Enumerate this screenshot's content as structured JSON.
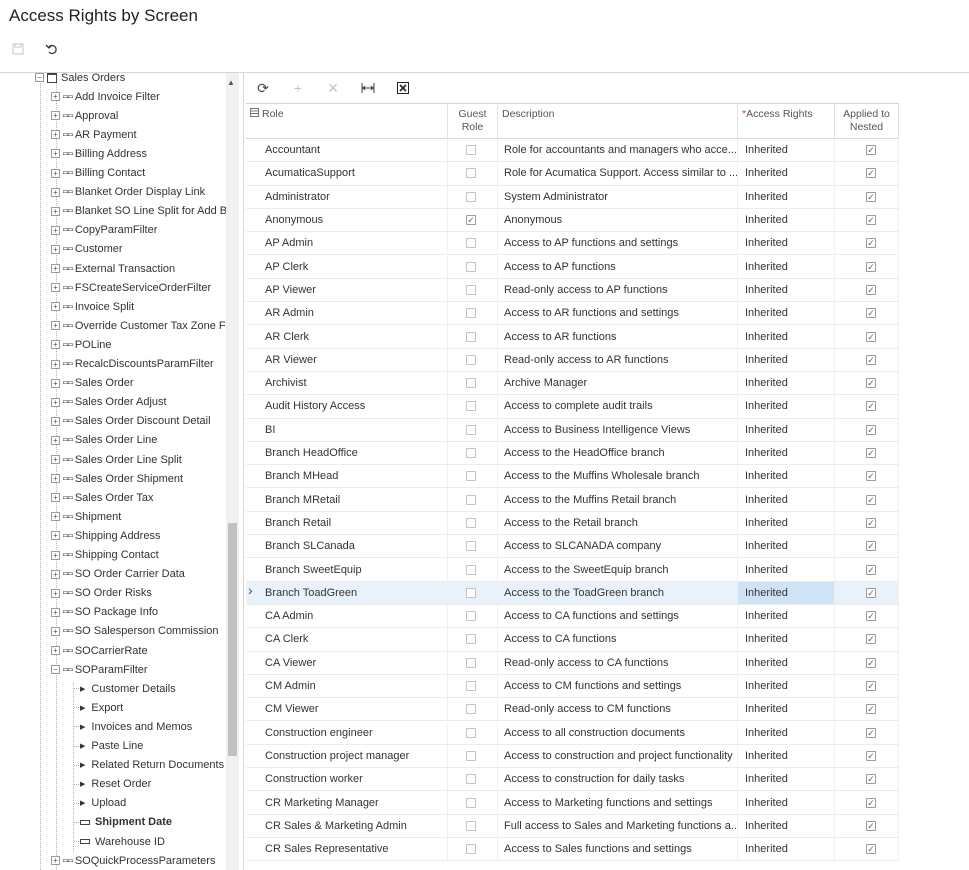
{
  "page": {
    "title": "Access Rights by Screen"
  },
  "toolbar": {
    "save_icon": "save-icon",
    "undo_icon": "undo-icon"
  },
  "tree": {
    "parent": "Sales Orders",
    "items": [
      "Add Invoice Filter",
      "Approval",
      "AR Payment",
      "Billing Address",
      "Billing Contact",
      "Blanket Order Display Link",
      "Blanket SO Line Split for Add B",
      "CopyParamFilter",
      "Customer",
      "External Transaction",
      "FSCreateServiceOrderFilter",
      "Invoice Split",
      "Override Customer Tax Zone Fi",
      "POLine",
      "RecalcDiscountsParamFilter",
      "Sales Order",
      "Sales Order Adjust",
      "Sales Order Discount Detail",
      "Sales Order Line",
      "Sales Order Line Split",
      "Sales Order Shipment",
      "Sales Order Tax",
      "Shipment",
      "Shipping Address",
      "Shipping Contact",
      "SO Order Carrier Data",
      "SO Order Risks",
      "SO Package Info",
      "SO Salesperson Commission",
      "SOCarrierRate",
      "SOParamFilter"
    ],
    "children": [
      "Customer Details",
      "Export",
      "Invoices and Memos",
      "Paste Line",
      "Related Return Documents",
      "Reset Order",
      "Upload"
    ],
    "fields": [
      "Shipment Date",
      "Warehouse ID"
    ],
    "last": "SOQuickProcessParameters"
  },
  "grid": {
    "columns": {
      "role": "Role",
      "guest_role": "Guest Role",
      "description": "Description",
      "access_rights_req": "*",
      "access_rights": "Access Rights",
      "applied_to_nested": "Applied to Nested"
    },
    "rows": [
      {
        "role": "Accountant",
        "guest": false,
        "desc": "Role for accountants and managers who acce...",
        "rights": "Inherited",
        "nested": true
      },
      {
        "role": "AcumaticaSupport",
        "guest": false,
        "desc": "Role for Acumatica Support. Access similar to ...",
        "rights": "Inherited",
        "nested": true
      },
      {
        "role": "Administrator",
        "guest": false,
        "desc": "System Administrator",
        "rights": "Inherited",
        "nested": true
      },
      {
        "role": "Anonymous",
        "guest": true,
        "desc": "Anonymous",
        "rights": "Inherited",
        "nested": true
      },
      {
        "role": "AP Admin",
        "guest": false,
        "desc": "Access to AP functions and settings",
        "rights": "Inherited",
        "nested": true
      },
      {
        "role": "AP Clerk",
        "guest": false,
        "desc": "Access to AP functions",
        "rights": "Inherited",
        "nested": true
      },
      {
        "role": "AP Viewer",
        "guest": false,
        "desc": "Read-only access to AP functions",
        "rights": "Inherited",
        "nested": true
      },
      {
        "role": "AR Admin",
        "guest": false,
        "desc": "Access to AR functions and settings",
        "rights": "Inherited",
        "nested": true
      },
      {
        "role": "AR Clerk",
        "guest": false,
        "desc": "Access to AR functions",
        "rights": "Inherited",
        "nested": true
      },
      {
        "role": "AR Viewer",
        "guest": false,
        "desc": "Read-only access to AR functions",
        "rights": "Inherited",
        "nested": true
      },
      {
        "role": "Archivist",
        "guest": false,
        "desc": "Archive Manager",
        "rights": "Inherited",
        "nested": true
      },
      {
        "role": "Audit History Access",
        "guest": false,
        "desc": "Access to complete audit trails",
        "rights": "Inherited",
        "nested": true
      },
      {
        "role": "BI",
        "guest": false,
        "desc": "Access to Business Intelligence Views",
        "rights": "Inherited",
        "nested": true
      },
      {
        "role": "Branch HeadOffice",
        "guest": false,
        "desc": "Access to the HeadOffice branch",
        "rights": "Inherited",
        "nested": true
      },
      {
        "role": "Branch MHead",
        "guest": false,
        "desc": "Access to the Muffins Wholesale branch",
        "rights": "Inherited",
        "nested": true
      },
      {
        "role": "Branch MRetail",
        "guest": false,
        "desc": "Access to the Muffins Retail branch",
        "rights": "Inherited",
        "nested": true
      },
      {
        "role": "Branch Retail",
        "guest": false,
        "desc": "Access to the Retail branch",
        "rights": "Inherited",
        "nested": true
      },
      {
        "role": "Branch SLCanada",
        "guest": false,
        "desc": "Access to SLCANADA company",
        "rights": "Inherited",
        "nested": true
      },
      {
        "role": "Branch SweetEquip",
        "guest": false,
        "desc": "Access to the SweetEquip branch",
        "rights": "Inherited",
        "nested": true
      },
      {
        "role": "Branch ToadGreen",
        "guest": false,
        "desc": "Access to the ToadGreen branch",
        "rights": "Inherited",
        "nested": true,
        "selected": true
      },
      {
        "role": "CA Admin",
        "guest": false,
        "desc": "Access to CA functions and settings",
        "rights": "Inherited",
        "nested": true
      },
      {
        "role": "CA Clerk",
        "guest": false,
        "desc": "Access to CA functions",
        "rights": "Inherited",
        "nested": true
      },
      {
        "role": "CA Viewer",
        "guest": false,
        "desc": "Read-only access to CA functions",
        "rights": "Inherited",
        "nested": true
      },
      {
        "role": "CM Admin",
        "guest": false,
        "desc": "Access to CM functions and settings",
        "rights": "Inherited",
        "nested": true
      },
      {
        "role": "CM Viewer",
        "guest": false,
        "desc": "Read-only access to CM functions",
        "rights": "Inherited",
        "nested": true
      },
      {
        "role": "Construction engineer",
        "guest": false,
        "desc": "Access to all construction documents",
        "rights": "Inherited",
        "nested": true
      },
      {
        "role": "Construction project manager",
        "guest": false,
        "desc": "Access to construction and project functionality",
        "rights": "Inherited",
        "nested": true
      },
      {
        "role": "Construction worker",
        "guest": false,
        "desc": "Access to construction for daily tasks",
        "rights": "Inherited",
        "nested": true
      },
      {
        "role": "CR Marketing Manager",
        "guest": false,
        "desc": "Access to Marketing functions and settings",
        "rights": "Inherited",
        "nested": true
      },
      {
        "role": "CR Sales & Marketing Admin",
        "guest": false,
        "desc": "Full access to Sales and Marketing functions a...",
        "rights": "Inherited",
        "nested": true
      },
      {
        "role": "CR Sales Representative",
        "guest": false,
        "desc": "Access to Sales functions and settings",
        "rights": "Inherited",
        "nested": true
      }
    ]
  }
}
